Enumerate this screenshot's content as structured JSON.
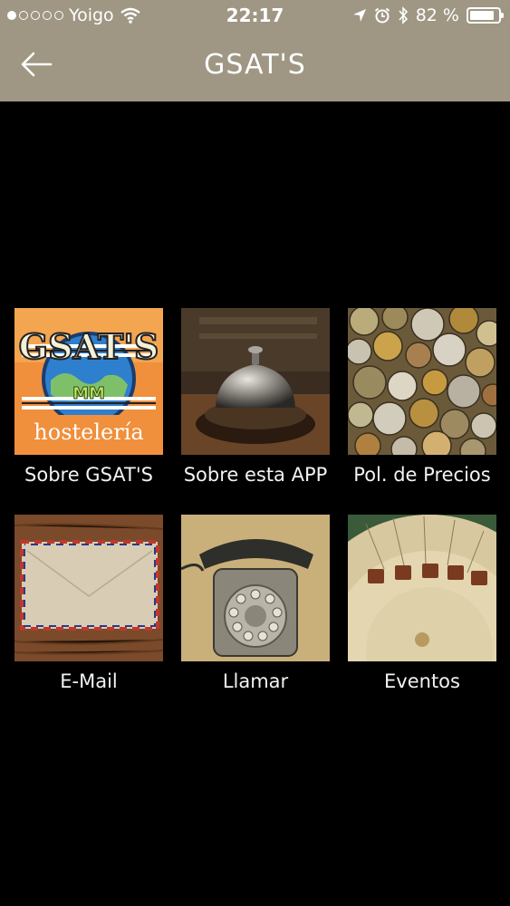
{
  "status_bar": {
    "carrier": "Yoigo",
    "time": "22:17",
    "battery": "82 %",
    "signal_bars_filled": 1,
    "signal_bars_total": 5
  },
  "nav": {
    "title": "GSAT'S",
    "back_icon": "arrow-left-icon"
  },
  "colors": {
    "header_bg": "#9f9784",
    "page_bg": "#000000",
    "text": "#ffffff"
  },
  "tiles": [
    {
      "label": "Sobre GSAT'S",
      "logo_text": "GSAT'S",
      "logo_badge": "MM",
      "logo_sub": "hostelería"
    },
    {
      "label": "Sobre esta APP"
    },
    {
      "label": "Pol. de Precios"
    },
    {
      "label": "E-Mail"
    },
    {
      "label": "Llamar"
    },
    {
      "label": "Eventos"
    }
  ]
}
